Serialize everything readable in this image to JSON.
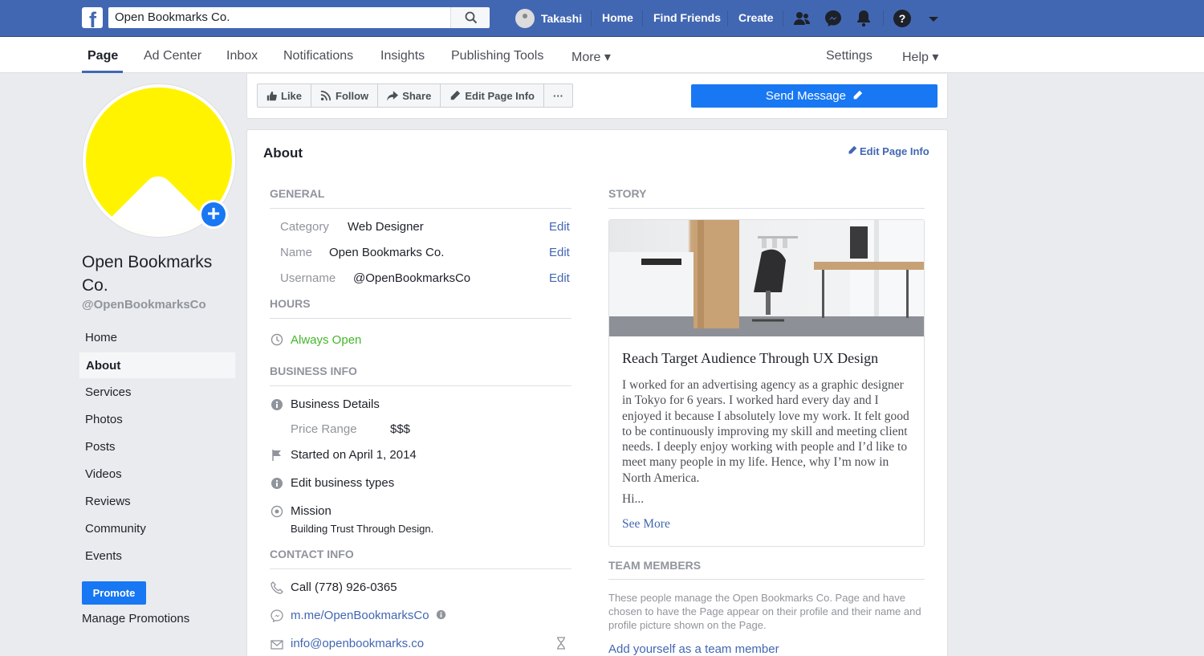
{
  "topbar": {
    "search_value": "Open Bookmarks Co.",
    "user_name": "Takashi",
    "links": [
      "Home",
      "Find Friends",
      "Create"
    ]
  },
  "subnav": {
    "tabs": [
      "Page",
      "Ad Center",
      "Inbox",
      "Notifications",
      "Insights",
      "Publishing Tools",
      "More ▾"
    ],
    "right": [
      "Settings",
      "Help ▾"
    ]
  },
  "profile": {
    "name": "Open Bookmarks Co.",
    "handle": "@OpenBookmarksCo"
  },
  "leftnav": {
    "items": [
      "Home",
      "About",
      "Services",
      "Photos",
      "Posts",
      "Videos",
      "Reviews",
      "Community",
      "Events"
    ],
    "promote": "Promote",
    "manage": "Manage Promotions"
  },
  "actions": {
    "like": "Like",
    "follow": "Follow",
    "share": "Share",
    "edit_page_info": "Edit Page Info",
    "more": "···",
    "send_message": "Send Message"
  },
  "about": {
    "title": "About",
    "edit_link": "Edit Page Info",
    "general": {
      "title": "General",
      "rows": [
        {
          "label": "Category",
          "value": "Web Designer",
          "action": "Edit"
        },
        {
          "label": "Name",
          "value": "Open Bookmarks Co.",
          "action": "Edit"
        },
        {
          "label": "Username",
          "value": "@OpenBookmarksCo",
          "action": "Edit"
        }
      ]
    },
    "hours": {
      "title": "Hours",
      "value": "Always Open"
    },
    "business": {
      "title": "Business Info",
      "details": "Business Details",
      "price_label": "Price Range",
      "price_value": "$$$",
      "started": "Started on April 1, 2014",
      "types": "Edit business types",
      "mission_label": "Mission",
      "mission_value": "Building Trust Through Design."
    },
    "contact": {
      "title": "Contact Info",
      "phone": "Call (778) 926-0365",
      "messenger": "m.me/OpenBookmarksCo",
      "email": "info@openbookmarks.co"
    }
  },
  "story": {
    "title": "Story",
    "headline": "Reach Target Audience Through UX Design",
    "body": "I worked for an advertising agency as a graphic designer in Tokyo for 6 years. I worked hard every day and I enjoyed it because I absolutely love my work. It felt good to be continuously improving my skill and meeting client needs. I deeply enjoy working with people and I’d like to meet many people in my life. Hence, why I’m now in North America.",
    "hi": "Hi...",
    "see_more": "See More"
  },
  "team": {
    "title": "Team Members",
    "description": "These people manage the Open Bookmarks Co. Page and have chosen to have the Page appear on their profile and their name and profile picture shown on the Page.",
    "add": "Add yourself as a team member"
  }
}
